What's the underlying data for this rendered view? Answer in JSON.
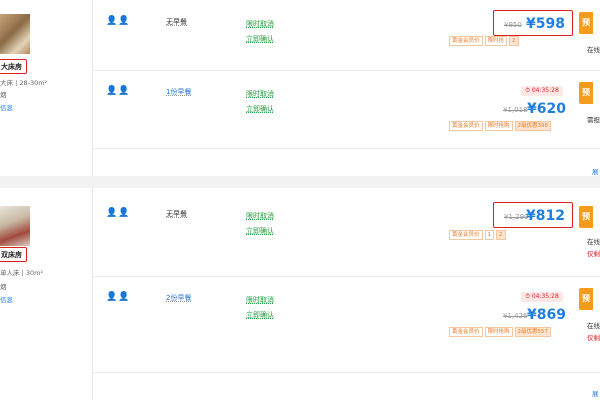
{
  "rooms": [
    {
      "name": "...床房",
      "name_visible": "大床房",
      "meta": "大床 | 28-30m²",
      "meta2": "烟",
      "more": "信息",
      "rates": [
        {
          "guests": "👤👤",
          "meal": "无早餐",
          "cancel1": "限时取消",
          "cancel2": "立即确认",
          "timer": "",
          "orig": "¥950",
          "price": "¥598",
          "tags": [
            "黄金会员价",
            "限时抢",
            "2"
          ],
          "book": "预",
          "after": "在线"
        },
        {
          "guests": "👤👤",
          "meal": "1份早餐",
          "cancel1": "限时取消",
          "cancel2": "立即确认",
          "timer": "04:35:28",
          "orig": "¥1,018",
          "price": "¥620",
          "tags": [
            "黄金会员价",
            "限时抢购",
            "2级优惠398"
          ],
          "book": "预",
          "after": "需担"
        }
      ],
      "expand": "展"
    },
    {
      "name": "双床房",
      "meta": "单人床 | 30m²",
      "meta2": "烟",
      "more": "信息",
      "rates": [
        {
          "guests": "👤👤",
          "meal": "无早餐",
          "cancel1": "限时取消",
          "cancel2": "立即确认",
          "timer": "",
          "orig": "¥1,290",
          "price": "¥812",
          "tags": [
            "黄金会员价",
            "1",
            "2"
          ],
          "book": "预",
          "after": "在线",
          "after2": "仅剩"
        },
        {
          "guests": "👤👤",
          "meal": "2份早餐",
          "cancel1": "限时取消",
          "cancel2": "立即确认",
          "timer": "04:35:28",
          "orig": "¥1,426",
          "price": "¥869",
          "tags": [
            "黄金会员价",
            "限时抢购",
            "2级优惠557"
          ],
          "book": "预",
          "after": "在线",
          "after2": "仅剩"
        }
      ],
      "expand": "展"
    }
  ]
}
